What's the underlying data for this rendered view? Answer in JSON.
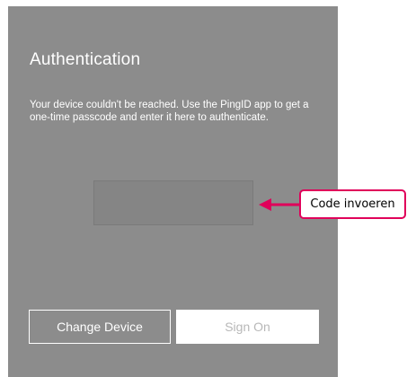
{
  "auth": {
    "title": "Authentication",
    "message": "Your device couldn't be reached. Use the PingID app to get a one-time passcode and enter it here to authenticate.",
    "passcode": {
      "value": "",
      "placeholder": ""
    },
    "buttons": {
      "change_device": "Change Device",
      "sign_on": "Sign On"
    }
  },
  "annotation": {
    "label": "Code invoeren",
    "color": "#e0005a"
  },
  "colors": {
    "panel_bg": "#8c8c8c",
    "text": "#ffffff",
    "disabled_text": "#b8b8b8"
  }
}
